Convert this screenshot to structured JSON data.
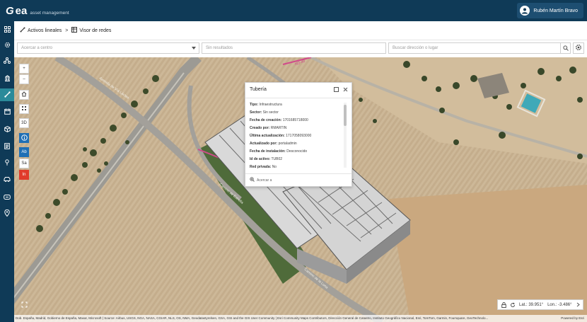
{
  "app": {
    "logo_mark": "G",
    "logo_name": "ea",
    "logo_sub": "asset management",
    "user_name": "Rubén Martín Bravo"
  },
  "breadcrumb": {
    "items": [
      {
        "label": "Activos lineales",
        "icon": "line-asset-icon"
      },
      {
        "label": "Visor de redes",
        "icon": "grid-view-icon"
      }
    ],
    "separator": ">"
  },
  "search": {
    "zoom_to_placeholder": "Acercar a centro",
    "results_placeholder": "Sin resultados",
    "address_placeholder": "Buscar dirección o lugar"
  },
  "sidebar": {
    "items": [
      {
        "icon": "dashboard-icon"
      },
      {
        "icon": "gear-icon"
      },
      {
        "icon": "network-icon"
      },
      {
        "icon": "building-icon"
      },
      {
        "icon": "pipe-line-icon",
        "active": true
      },
      {
        "icon": "calendar-icon"
      },
      {
        "icon": "box-icon"
      },
      {
        "icon": "document-icon"
      },
      {
        "icon": "pin-icon"
      },
      {
        "icon": "vehicle-icon"
      },
      {
        "icon": "id-card-icon"
      },
      {
        "icon": "location-icon"
      }
    ]
  },
  "map_tools": {
    "zoom_in": "+",
    "zoom_out": "–",
    "three_d": "3D",
    "ab": "Ab",
    "sa": "Sa",
    "in": "In"
  },
  "map_labels": {
    "road_tag": "NO-40"
  },
  "popup": {
    "title": "Tubería",
    "attributes": [
      {
        "label": "Tipo:",
        "value": "Infraestructura"
      },
      {
        "label": "Sector:",
        "value": "Sin sector"
      },
      {
        "label": "Fecha de creación:",
        "value": "1701685718000"
      },
      {
        "label": "Creado por:",
        "value": "RMARTIN"
      },
      {
        "label": "Última actualización:",
        "value": "1717058093000"
      },
      {
        "label": "Actualizado por:",
        "value": "portaladmin"
      },
      {
        "label": "Fecha de instalación:",
        "value": "Desconocido"
      },
      {
        "label": "Id de activo:",
        "value": "TUB02"
      },
      {
        "label": "Red privada:",
        "value": "No"
      }
    ],
    "zoom_to": "Acercar a"
  },
  "coords": {
    "lat": "Lat.: 39.951°",
    "lon": "Lon.: -3.486°"
  },
  "attribution": {
    "text": "Dob. España, Madrid, Gobierno de España, Maxar, Microsoft | Source: Airbus, USGS, NGA, NASA, CGIAR, NLS, OS, NMA, Geodatastyrelsen, GSA, GSI and the GIS User Community | Esri Community Maps Contributors, Dirección General de Catastro, Instituto Geográfico Nacional, Esri, TomTom, Garmin, Foursquare, GeoTechnolo...",
    "powered": "Powered by Esri"
  },
  "colors": {
    "nav": "#0f3a57",
    "active": "#2a8a9a",
    "tool_blue": "#1f6fb5",
    "tool_red": "#e03b2c"
  }
}
